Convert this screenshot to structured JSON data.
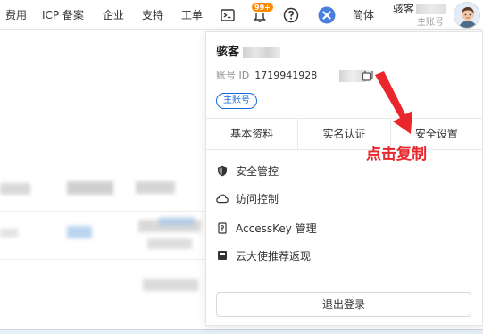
{
  "nav": {
    "items": [
      "费用",
      "ICP 备案",
      "企业",
      "支持",
      "工单"
    ],
    "badge": "99+",
    "lang": "简体",
    "user_name": "骇客",
    "account_type": "主账号"
  },
  "panel": {
    "name": "骇客",
    "account_id_label": "账号 ID",
    "account_id": "1719941928",
    "main_tag": "主账号",
    "tabs": [
      "基本资料",
      "实名认证",
      "安全设置"
    ],
    "menu": [
      {
        "label": "安全管控",
        "icon": "shield-icon"
      },
      {
        "label": "访问控制",
        "icon": "cloud-icon"
      },
      {
        "label": "AccessKey 管理",
        "icon": "key-icon"
      },
      {
        "label": "云大使推荐返现",
        "icon": "gift-icon"
      }
    ],
    "logout": "退出登录"
  },
  "annotation": {
    "text": "点击复制",
    "color": "#e8262b"
  },
  "colors": {
    "accent": "#1668dc",
    "badge": "#ff8a00",
    "help_icon": "#4a7fe0"
  }
}
